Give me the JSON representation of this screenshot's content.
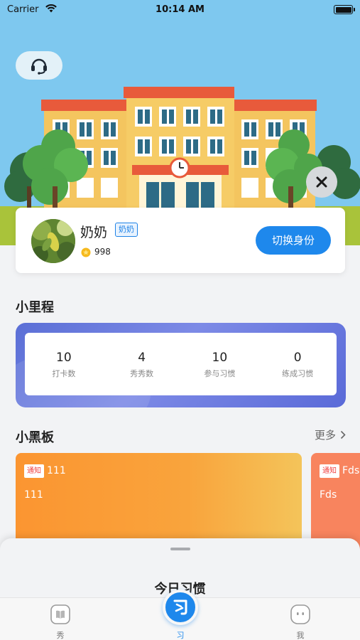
{
  "status_bar": {
    "carrier": "Carrier",
    "time": "10:14 AM"
  },
  "profile": {
    "name": "奶奶",
    "role": "奶奶",
    "points": "998",
    "switch_label": "切换身份"
  },
  "mileage": {
    "title": "小里程",
    "stats": [
      {
        "value": "10",
        "label": "打卡数"
      },
      {
        "value": "4",
        "label": "秀秀数"
      },
      {
        "value": "10",
        "label": "参与习惯"
      },
      {
        "value": "0",
        "label": "练成习惯"
      }
    ]
  },
  "blackboard": {
    "title": "小黑板",
    "more_label": "更多",
    "cards": [
      {
        "tag": "通知",
        "title": "111",
        "body": "111"
      },
      {
        "tag": "通知",
        "title": "Fds",
        "body": "Fds"
      }
    ]
  },
  "sheet": {
    "title": "今日习惯"
  },
  "tabbar": {
    "items": [
      {
        "label": "秀",
        "icon": "book-icon"
      },
      {
        "label": "习",
        "icon": "habit-icon"
      },
      {
        "label": "我",
        "icon": "face-icon"
      }
    ]
  },
  "colors": {
    "accent": "#1e88ec",
    "sky": "#7ec8ef",
    "card_orange": "#fb9531",
    "card_coral": "#f8845e",
    "mileage_frame": "#5b6fd6",
    "notice_red": "#f04141"
  }
}
